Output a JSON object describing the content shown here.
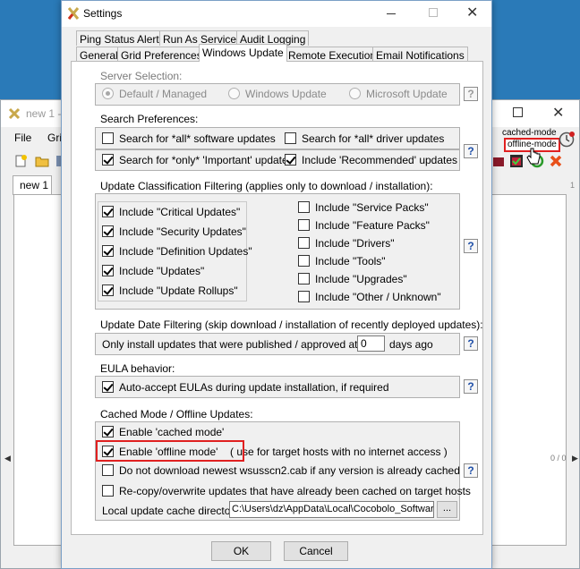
{
  "background_app": {
    "title": "new 1 -",
    "menu": [
      "File",
      "Gri"
    ],
    "tab": "new 1",
    "mode_cached": "cached-mode",
    "mode_offline": "offline-mode",
    "ruler_num": "1",
    "page_count": "0 / 0"
  },
  "dialog": {
    "title": "Settings",
    "tabs_row1": [
      "Ping Status Alerts",
      "Run As Service",
      "Audit Logging"
    ],
    "tabs_row2": [
      "General",
      "Grid Preferences",
      "Windows Update",
      "Remote Execution",
      "Email Notifications"
    ],
    "active_tab": "Windows Update",
    "server_selection": {
      "title": "Server Selection:",
      "options": [
        "Default / Managed",
        "Windows Update",
        "Microsoft Update"
      ],
      "selected": "Default / Managed"
    },
    "search_prefs": {
      "title": "Search Preferences:",
      "items": [
        {
          "label": "Search for *all* software updates",
          "checked": false
        },
        {
          "label": "Search for *all* driver updates",
          "checked": false
        },
        {
          "label": "Search for *only* 'Important' updates",
          "checked": true
        },
        {
          "label": "Include 'Recommended' updates",
          "checked": true
        }
      ]
    },
    "classification": {
      "title": "Update Classification Filtering (applies only to download / installation):",
      "left": [
        {
          "label": "Include \"Critical Updates\"",
          "checked": true
        },
        {
          "label": "Include \"Security Updates\"",
          "checked": true
        },
        {
          "label": "Include \"Definition Updates\"",
          "checked": true
        },
        {
          "label": "Include \"Updates\"",
          "checked": true
        },
        {
          "label": "Include \"Update Rollups\"",
          "checked": true
        }
      ],
      "right": [
        {
          "label": "Include \"Service Packs\"",
          "checked": false
        },
        {
          "label": "Include \"Feature Packs\"",
          "checked": false
        },
        {
          "label": "Include \"Drivers\"",
          "checked": false
        },
        {
          "label": "Include \"Tools\"",
          "checked": false
        },
        {
          "label": "Include \"Upgrades\"",
          "checked": false
        },
        {
          "label": "Include \"Other / Unknown\"",
          "checked": false
        }
      ]
    },
    "date_filter": {
      "title": "Update Date Filtering (skip download / installation of recently deployed updates):",
      "text_before": "Only install updates that were published / approved at least",
      "days": "0",
      "text_after": "days ago"
    },
    "eula": {
      "title": "EULA behavior:",
      "label": "Auto-accept EULAs during update installation, if required",
      "checked": true
    },
    "cached": {
      "title": "Cached Mode / Offline Updates:",
      "items": [
        {
          "label": "Enable 'cached mode'",
          "checked": true
        },
        {
          "label": "Enable 'offline mode'",
          "checked": true
        },
        {
          "label": "Do not download newest wsusscn2.cab if any version is already cached",
          "checked": false
        },
        {
          "label": "Re-copy/overwrite updates that have already been cached on target hosts",
          "checked": false
        }
      ],
      "offline_note": "( use for target hosts with no internet access )",
      "cache_dir_label": "Local update cache directory:",
      "cache_dir_value": "C:\\Users\\dz\\AppData\\Local\\Cocobolo_Software\\",
      "browse_label": "..."
    },
    "hint_label": "?",
    "ok_label": "OK",
    "cancel_label": "Cancel"
  }
}
